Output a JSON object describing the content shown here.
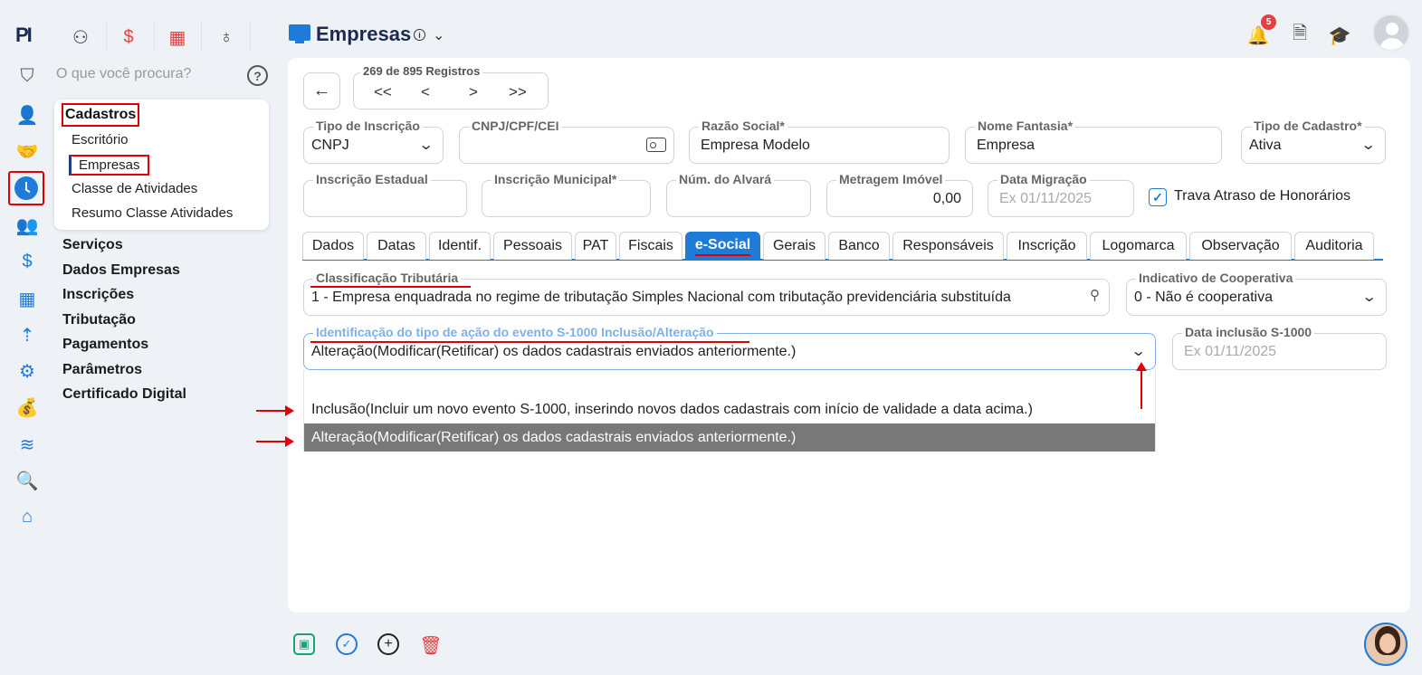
{
  "app": {
    "logo_text": "PI"
  },
  "search": {
    "placeholder": "O que você procura?"
  },
  "submenu": {
    "title": "Cadastros",
    "items": [
      "Escritório",
      "Empresas",
      "Classe de Atividades",
      "Resumo Classe Atividades"
    ]
  },
  "menu": {
    "items": [
      "Serviços",
      "Dados Empresas",
      "Inscrições",
      "Tributação",
      "Pagamentos",
      "Parâmetros",
      "Certificado Digital"
    ]
  },
  "header": {
    "title": "Empresas",
    "notification_count": "5"
  },
  "navigation": {
    "records_label": "269 de 895 Registros",
    "first": "<<",
    "prev": "<",
    "next": ">",
    "last": ">>"
  },
  "form": {
    "tipo_inscricao": {
      "label": "Tipo de Inscrição",
      "value": "CNPJ"
    },
    "cnpj": {
      "label": "CNPJ/CPF/CEI",
      "value": ""
    },
    "razao_social": {
      "label": "Razão Social*",
      "value": "Empresa Modelo"
    },
    "nome_fantasia": {
      "label": "Nome Fantasia*",
      "value": "Empresa"
    },
    "tipo_cadastro": {
      "label": "Tipo de Cadastro*",
      "value": "Ativa"
    },
    "inscricao_estadual": {
      "label": "Inscrição Estadual",
      "value": ""
    },
    "inscricao_municipal": {
      "label": "Inscrição Municipal*",
      "value": ""
    },
    "num_alvara": {
      "label": "Núm. do Alvará",
      "value": ""
    },
    "metragem": {
      "label": "Metragem Imóvel",
      "value": "0,00"
    },
    "data_migracao": {
      "label": "Data Migração",
      "placeholder": "Ex 01/11/2025"
    },
    "trava_atraso": {
      "label": "Trava Atraso de Honorários",
      "checked": true
    }
  },
  "tabs": [
    "Dados",
    "Datas",
    "Identif.",
    "Pessoais",
    "PAT",
    "Fiscais",
    "e-Social",
    "Gerais",
    "Banco",
    "Responsáveis",
    "Inscrição",
    "Logomarca",
    "Observação",
    "Auditoria"
  ],
  "active_tab": "e-Social",
  "esocial": {
    "classificacao": {
      "label": "Classificação Tributária",
      "value": "1 - Empresa enquadrada no regime de tributação Simples Nacional com tributação previdenciária substituída"
    },
    "cooperativa": {
      "label": "Indicativo de Cooperativa",
      "value": "0 - Não é cooperativa"
    },
    "acao_evento": {
      "label": "Identificação do tipo de ação do evento S-1000 Inclusão/Alteração",
      "value": "Alteração(Modificar(Retificar) os dados cadastrais enviados anteriormente.)"
    },
    "data_inclusao": {
      "label": "Data inclusão S-1000",
      "placeholder": "Ex 01/11/2025"
    },
    "options": [
      "Inclusão(Incluir um novo evento S-1000, inserindo novos dados cadastrais com início de validade a data acima.)",
      "Alteração(Modificar(Retificar) os dados cadastrais enviados anteriormente.)"
    ],
    "selected_option": 1
  },
  "colors": {
    "accent": "#1f7bd8",
    "annotation": "#e00000",
    "selected_option_bg": "#787878"
  }
}
